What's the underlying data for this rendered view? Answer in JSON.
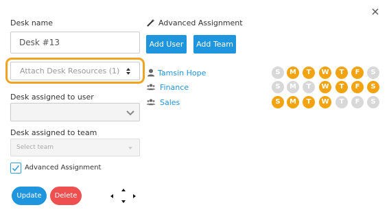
{
  "form": {
    "desk_name_label": "Desk name",
    "desk_name_value": "Desk #13",
    "resources_placeholder": "Attach Desk Resources (1)",
    "user_label": "Desk assigned to user",
    "user_value": "",
    "team_label": "Desk assigned to team",
    "team_placeholder": "Select team",
    "advanced_checkbox_label": "Advanced Assignment",
    "advanced_checked": true
  },
  "actions": {
    "update_label": "Update",
    "delete_label": "Delete"
  },
  "advanced": {
    "heading": "Advanced Assignment",
    "add_user_label": "Add User",
    "add_team_label": "Add Team",
    "day_letters": [
      "S",
      "M",
      "T",
      "W",
      "T",
      "F",
      "S"
    ],
    "assignments": [
      {
        "type": "user",
        "icon": "user-icon",
        "name": "Tamsin Hope",
        "days_active": [
          false,
          true,
          true,
          true,
          true,
          true,
          false
        ]
      },
      {
        "type": "team",
        "icon": "team-icon",
        "name": "Finance",
        "days_active": [
          false,
          false,
          false,
          true,
          true,
          true,
          true
        ]
      },
      {
        "type": "team",
        "icon": "team-icon",
        "name": "Sales",
        "days_active": [
          true,
          true,
          true,
          true,
          false,
          false,
          false
        ]
      }
    ]
  },
  "colors": {
    "accent": "#1f95dd",
    "danger": "#ee4f4f",
    "highlight": "#f0a31f",
    "day_active": "#f2a30f",
    "day_inactive": "#d8d8d8"
  }
}
